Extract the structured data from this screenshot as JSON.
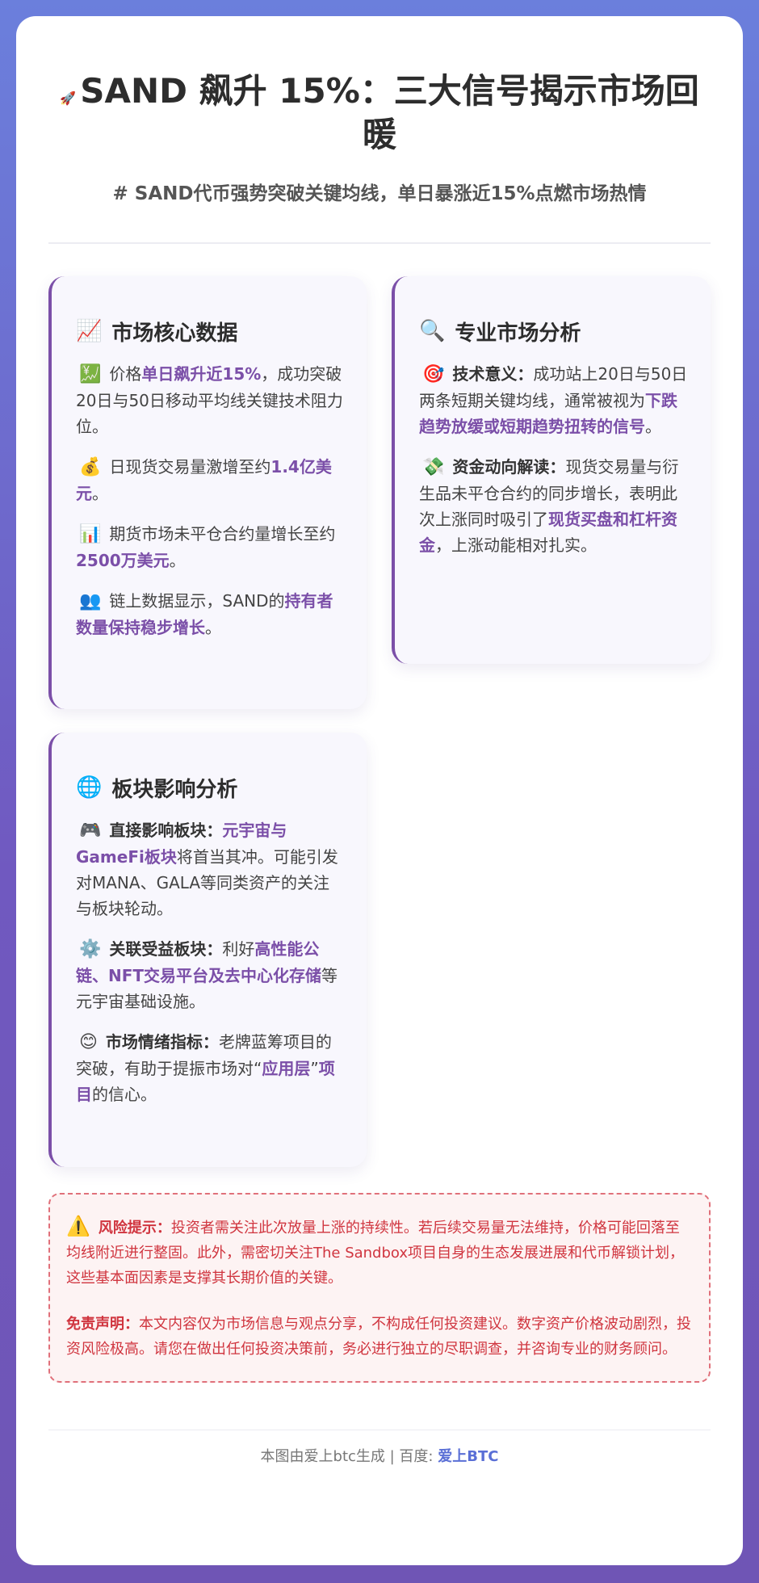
{
  "header": {
    "icon": "🚀",
    "icon_name": "rocket-icon",
    "title": "SAND 飙升 15%：三大信号揭示市场回暖",
    "subtitle": "# SAND代币强势突破关键均线，单日暴涨近15%点燃市场热情"
  },
  "panels": [
    {
      "icon": "📈",
      "icon_name": "chart-up-icon",
      "title": "市场核心数据",
      "items": [
        {
          "icon": "💹",
          "icon_name": "chart-yen-icon",
          "parts": [
            {
              "t": "价格"
            },
            {
              "t": "单日飙升近",
              "hl": true
            },
            {
              "t": "15%",
              "hl": true
            },
            {
              "t": "，成功突破20日与50日移动平均线关键技术阻力位。"
            }
          ]
        },
        {
          "icon": "💰",
          "icon_name": "money-bag-icon",
          "parts": [
            {
              "t": "日现货交易量激增至约"
            },
            {
              "t": "1.4亿美元",
              "hl": true
            },
            {
              "t": "。"
            }
          ]
        },
        {
          "icon": "📊",
          "icon_name": "bar-chart-icon",
          "parts": [
            {
              "t": "期货市场未平仓合约量增长至约"
            },
            {
              "t": "2500万美元",
              "hl": true
            },
            {
              "t": "。"
            }
          ]
        },
        {
          "icon": "👥",
          "icon_name": "users-icon",
          "parts": [
            {
              "t": "链上数据显示，SAND的"
            },
            {
              "t": "持有者数量保持稳步增长",
              "hl": true
            },
            {
              "t": "。"
            }
          ]
        }
      ]
    },
    {
      "icon": "🔍",
      "icon_name": "magnifier-icon",
      "title": "专业市场分析",
      "items": [
        {
          "icon": "🎯",
          "icon_name": "target-icon",
          "parts": [
            {
              "t": "技术意义：",
              "lbl": true
            },
            {
              "t": "成功站上20日与50日两条短期关键均线，通常被视为"
            },
            {
              "t": "下跌趋势放缓或短期趋势扭转的信号",
              "hl": true
            },
            {
              "t": "。"
            }
          ]
        },
        {
          "icon": "💸",
          "icon_name": "money-flow-icon",
          "parts": [
            {
              "t": "资金动向解读：",
              "lbl": true
            },
            {
              "t": "现货交易量与衍生品未平仓合约的同步增长，表明此次上涨同时吸引了"
            },
            {
              "t": "现货买盘和杠杆资金",
              "hl": true
            },
            {
              "t": "，上涨动能相对扎实。"
            }
          ]
        }
      ]
    },
    {
      "icon": "🌐",
      "icon_name": "globe-icon",
      "title": "板块影响分析",
      "items": [
        {
          "icon": "🎮",
          "icon_name": "gamepad-icon",
          "parts": [
            {
              "t": "直接影响板块：",
              "lbl": true
            },
            {
              "t": "元宇宙与GameFi板块",
              "hl": true
            },
            {
              "t": "将首当其冲。可能引发对MANA、GALA等同类资产的关注与板块轮动。"
            }
          ]
        },
        {
          "icon": "⚙️",
          "icon_name": "gear-icon",
          "parts": [
            {
              "t": "关联受益板块：",
              "lbl": true
            },
            {
              "t": "利好"
            },
            {
              "t": "高性能公链、NFT交易平台及去中心化存储",
              "hl": true
            },
            {
              "t": "等元宇宙基础设施。"
            }
          ]
        },
        {
          "icon": "😊",
          "icon_name": "smile-icon",
          "parts": [
            {
              "t": "市场情绪指标：",
              "lbl": true
            },
            {
              "t": "老牌蓝筹项目的突破，有助于提振市场对“"
            },
            {
              "t": "应用层",
              "hl": true
            },
            {
              "t": "”"
            },
            {
              "t": "项目",
              "hl": true
            },
            {
              "t": "的信心。"
            }
          ]
        }
      ]
    }
  ],
  "risk": {
    "icon": "⚠️",
    "icon_name": "warning-icon",
    "label": "风险提示：",
    "text": "投资者需关注此次放量上涨的持续性。若后续交易量无法维持，价格可能回落至均线附近进行整固。此外，需密切关注The Sandbox项目自身的生态发展进展和代币解锁计划，这些基本面因素是支撑其长期价值的关键。",
    "disclaimer_label": "免责声明：",
    "disclaimer_text": "本文内容仅为市场信息与观点分享，不构成任何投资建议。数字资产价格波动剧烈，投资风险极高。请您在做出任何投资决策前，务必进行独立的尽职调查，并咨询专业的财务顾问。"
  },
  "footer": {
    "text": "本图由爱上btc生成 | 百度: ",
    "brand": "爱上BTC"
  },
  "colors": {
    "accent": "#7b4fa8",
    "risk": "#d0353f",
    "brand": "#5a6fd6"
  }
}
